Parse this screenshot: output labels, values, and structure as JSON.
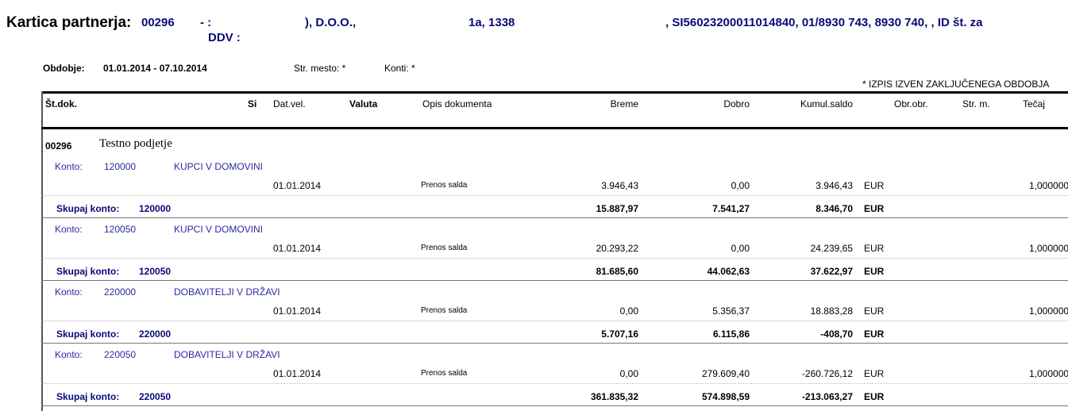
{
  "header": {
    "title": "Kartica partnerja:",
    "partner_code": "00296",
    "name_part1": "- :",
    "name_part2": "), D.O.O.,",
    "address": "1a, 1338",
    "details": ", SI56023200011014840, 01/8930 743, 8930 740, , ID št. za",
    "ddv": "DDV :"
  },
  "filters": {
    "period_label": "Obdobje:",
    "period_value": "01.01.2014 - 07.10.2014",
    "cost_center": "Str. mesto: *",
    "accounts": "Konti: *",
    "notice": "* IZPIS IZVEN ZAKLJUČENEGA OBDOBJA"
  },
  "columns": [
    "Št.dok.",
    "Si",
    "Dat.vel.",
    "Valuta",
    "Opis dokumenta",
    "Breme",
    "Dobro",
    "Kumul.saldo",
    "Obr.obr.",
    "Str. m.",
    "Tečaj"
  ],
  "group": {
    "code": "00296",
    "name": "Testno podjetje"
  },
  "konto_label": "Konto:",
  "total_label": "Skupaj konto:",
  "accounts": [
    {
      "konto": "120000",
      "name": "KUPCI V DOMOVINI",
      "row": {
        "date": "01.01.2014",
        "desc": "Prenos salda",
        "debit": "3.946,43",
        "credit": "0,00",
        "balance": "3.946,43",
        "currency": "EUR",
        "rate": "1,000000"
      },
      "total": {
        "debit": "15.887,97",
        "credit": "7.541,27",
        "balance": "8.346,70",
        "currency": "EUR"
      }
    },
    {
      "konto": "120050",
      "name": "KUPCI V DOMOVINI",
      "row": {
        "date": "01.01.2014",
        "desc": "Prenos salda",
        "debit": "20.293,22",
        "credit": "0,00",
        "balance": "24.239,65",
        "currency": "EUR",
        "rate": "1,000000"
      },
      "total": {
        "debit": "81.685,60",
        "credit": "44.062,63",
        "balance": "37.622,97",
        "currency": "EUR"
      }
    },
    {
      "konto": "220000",
      "name": "DOBAVITELJI V DRŽAVI",
      "row": {
        "date": "01.01.2014",
        "desc": "Prenos salda",
        "debit": "0,00",
        "credit": "5.356,37",
        "balance": "18.883,28",
        "currency": "EUR",
        "rate": "1,000000"
      },
      "total": {
        "debit": "5.707,16",
        "credit": "6.115,86",
        "balance": "-408,70",
        "currency": "EUR"
      }
    },
    {
      "konto": "220050",
      "name": "DOBAVITELJI V DRŽAVI",
      "row": {
        "date": "01.01.2014",
        "desc": "Prenos salda",
        "debit": "0,00",
        "credit": "279.609,40",
        "balance": "-260.726,12",
        "currency": "EUR",
        "rate": "1,000000"
      },
      "total": {
        "debit": "361.835,32",
        "credit": "574.898,59",
        "balance": "-213.063,27",
        "currency": "EUR"
      }
    }
  ]
}
